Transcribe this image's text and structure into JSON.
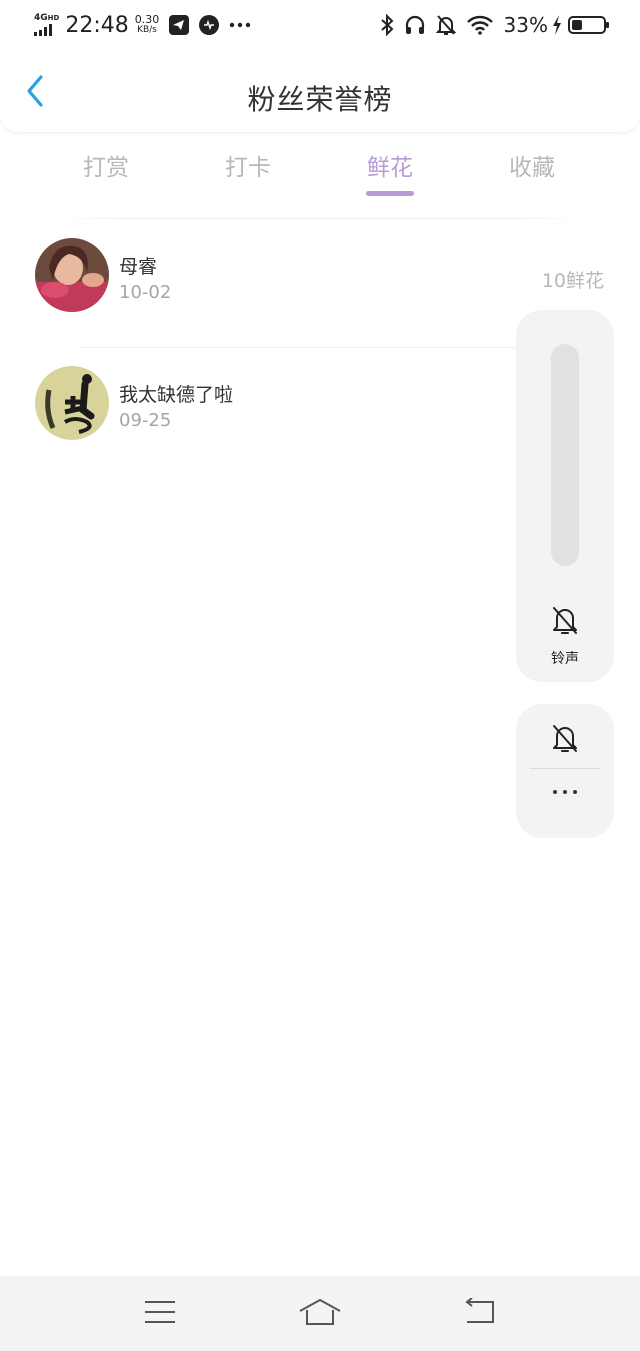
{
  "status_bar": {
    "network": "4G",
    "network_hd": "HD",
    "time": "22:48",
    "speed_value": "0.30",
    "speed_unit": "KB/s",
    "battery_percent": "33%",
    "battery_level": 0.33,
    "icons": [
      "signal-icon",
      "telegram-icon",
      "app-icon",
      "more-icon",
      "bluetooth-icon",
      "headphones-icon",
      "bell-mute-icon",
      "wifi-icon",
      "charging-icon",
      "battery-icon"
    ]
  },
  "header": {
    "title": "粉丝荣誉榜",
    "back_icon": "chevron-left-icon",
    "accent_color": "#2a9fe4"
  },
  "tabs": [
    {
      "label": "打赏",
      "active": false
    },
    {
      "label": "打卡",
      "active": false
    },
    {
      "label": "鲜花",
      "active": true
    },
    {
      "label": "收藏",
      "active": false
    }
  ],
  "active_color": "#b69bd7",
  "list": [
    {
      "name": "母睿",
      "date": "10-02",
      "value": "10鲜花"
    },
    {
      "name": "我太缺德了啦",
      "date": "09-25",
      "value": ""
    }
  ],
  "volume_panel": {
    "label": "铃声",
    "icon": "bell-mute-icon"
  },
  "mini_panel": {
    "icon": "bell-mute-icon",
    "more_icon": "more-horizontal-icon"
  },
  "nav_bar": {
    "icons": [
      "menu-icon",
      "home-icon",
      "back-icon"
    ]
  }
}
